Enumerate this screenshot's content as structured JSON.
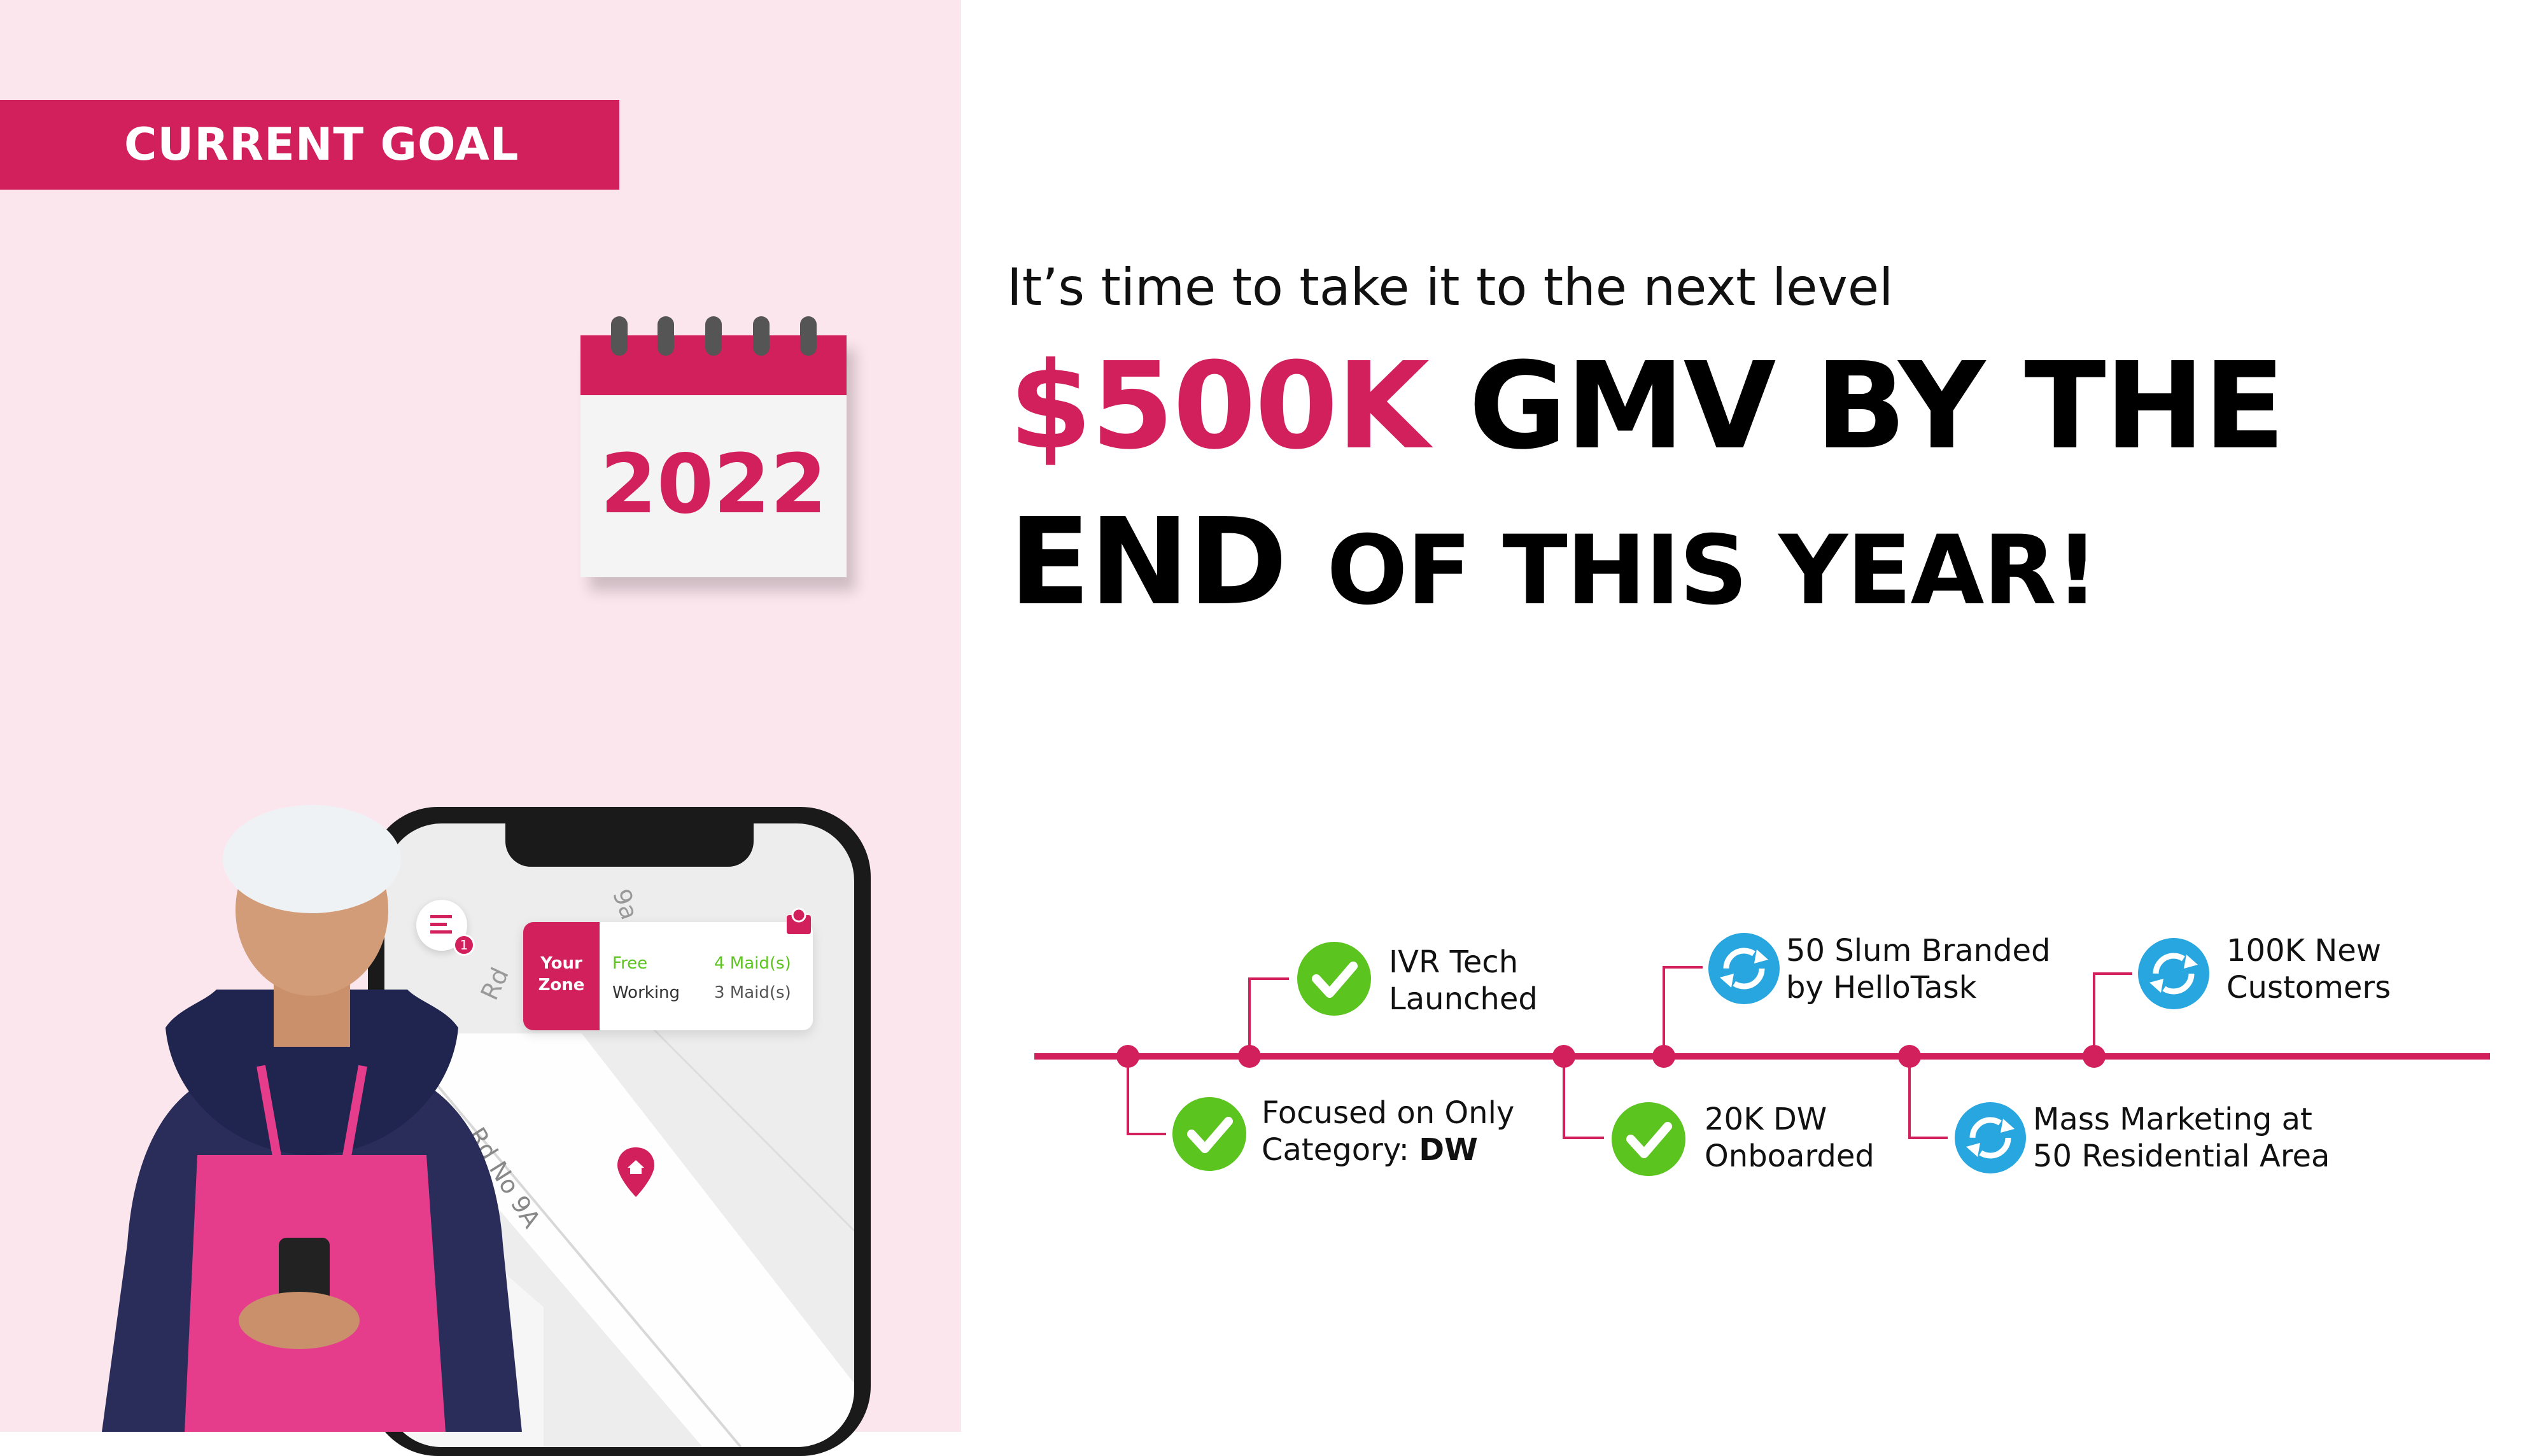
{
  "banner": {
    "label": "CURRENT GOAL"
  },
  "calendar": {
    "year": "2022"
  },
  "hero": {
    "subtitle": "It’s time to take it to the next level",
    "amount": "$500K",
    "line1_rest": "GMV BY THE",
    "line2_end": "END",
    "line2_rest": "OF THIS YEAR!"
  },
  "phone": {
    "zone_line1": "Your",
    "zone_line2": "Zone",
    "free_label": "Free",
    "free_count": "4 Maid(s)",
    "working_label": "Working",
    "working_count": "3 Maid(s)",
    "notification_count": "1",
    "road_label": "Rd No 9A",
    "road_partial": "Rd",
    "road_partial_top": "9a"
  },
  "milestones": [
    {
      "line1": "Focused on Only",
      "line2_prefix": "Category: ",
      "line2_bold": "DW",
      "status": "done"
    },
    {
      "line1": "IVR Tech",
      "line2": "Launched",
      "status": "done"
    },
    {
      "line1": "20K DW",
      "line2": "Onboarded",
      "status": "done"
    },
    {
      "line1": "50 Slum Branded",
      "line2": "by HelloTask",
      "status": "in-progress"
    },
    {
      "line1": "Mass Marketing at",
      "line2": "50 Residential Area",
      "status": "in-progress"
    },
    {
      "line1": "100K New",
      "line2": "Customers",
      "status": "in-progress"
    }
  ],
  "colors": {
    "brand_pink": "#d2205d",
    "left_bg": "#fce6ee",
    "done_green": "#5cc41e",
    "progress_blue": "#27a6e0"
  }
}
